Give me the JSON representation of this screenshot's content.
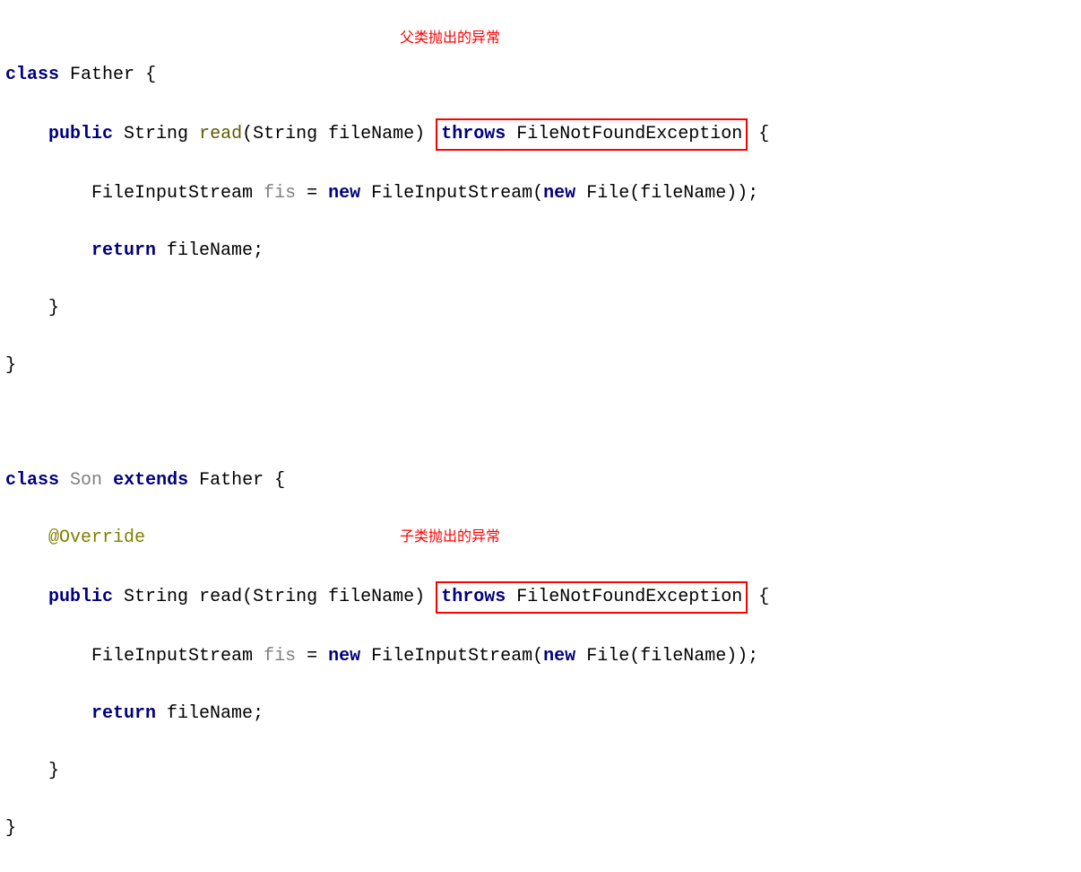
{
  "callouts": {
    "father": "父类抛出的异常",
    "son": "子类抛出的异常"
  },
  "kw": {
    "class": "class",
    "public": "public",
    "new": "new",
    "return": "return",
    "extends": "extends",
    "throws": "throws"
  },
  "annotation": "@Override",
  "types": {
    "String": "String",
    "FileInputStream": "FileInputStream",
    "File": "File",
    "FNFE": "FileNotFoundException"
  },
  "names": {
    "Father": "Father",
    "Son": "Son",
    "read": "read",
    "fileName": "fileName",
    "fis": "fis"
  },
  "punct": {
    "obrace": "{",
    "cbrace": "}",
    "op": "(",
    "cp": ")",
    "semi": ";",
    "eq": " = "
  }
}
